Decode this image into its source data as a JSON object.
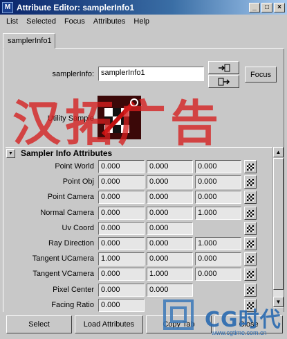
{
  "window": {
    "title": "Attribute Editor: samplerInfo1",
    "controls": [
      "_",
      "□",
      "×"
    ]
  },
  "menu": [
    "List",
    "Selected",
    "Focus",
    "Attributes",
    "Help"
  ],
  "tab": "samplerInfo1",
  "node": {
    "name_label": "samplerInfo:",
    "name_value": "samplerInfo1",
    "focus_label": "Focus",
    "swatch_label": "Utility Sample"
  },
  "watermark": "汉拓广告",
  "section": {
    "title": "Sampler Info Attributes",
    "rows": [
      {
        "label": "Point World",
        "values": [
          "0.000",
          "0.000",
          "0.000"
        ]
      },
      {
        "label": "Point Obj",
        "values": [
          "0.000",
          "0.000",
          "0.000"
        ]
      },
      {
        "label": "Point Camera",
        "values": [
          "0.000",
          "0.000",
          "0.000"
        ]
      },
      {
        "label": "Normal Camera",
        "values": [
          "0.000",
          "0.000",
          "1.000"
        ]
      },
      {
        "label": "Uv Coord",
        "values": [
          "0.000",
          "0.000"
        ]
      },
      {
        "label": "Ray Direction",
        "values": [
          "0.000",
          "0.000",
          "1.000"
        ]
      },
      {
        "label": "Tangent UCamera",
        "values": [
          "1.000",
          "0.000",
          "0.000"
        ]
      },
      {
        "label": "Tangent VCamera",
        "values": [
          "0.000",
          "1.000",
          "0.000"
        ]
      },
      {
        "label": "Pixel Center",
        "values": [
          "0.000",
          "0.000"
        ]
      },
      {
        "label": "Facing Ratio",
        "values": [
          "0.000"
        ]
      }
    ]
  },
  "buttons": {
    "select": "Select",
    "load": "Load Attributes",
    "copy": "Copy Tab",
    "close": "Close"
  },
  "logo": {
    "brand": "CG时代",
    "url": "www.cgtime.com.cn"
  }
}
